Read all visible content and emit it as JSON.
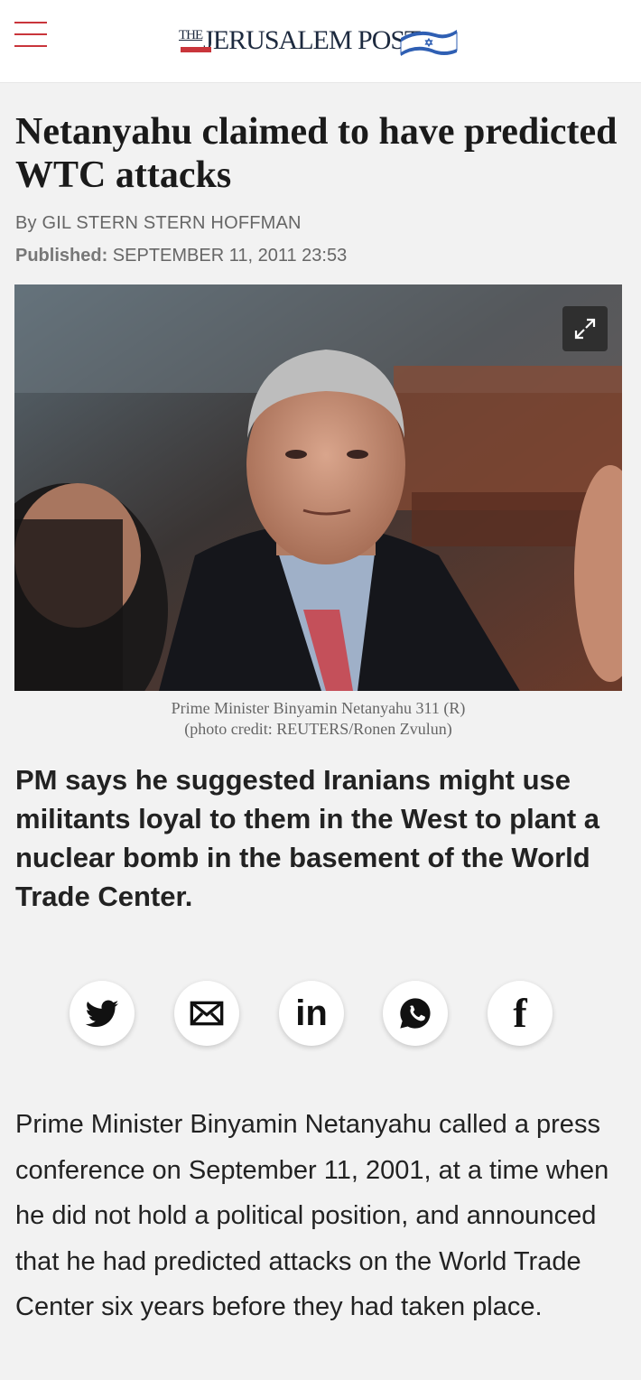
{
  "header": {
    "logo": {
      "the": "THE",
      "name": "JERUSALEM POST"
    }
  },
  "article": {
    "headline": "Netanyahu claimed to have predicted WTC attacks",
    "byline": "By GIL STERN STERN HOFFMAN",
    "published_label": "Published:",
    "published_date": "SEPTEMBER 11, 2011 23:53",
    "image": {
      "caption_line1": "Prime Minister Binyamin Netanyahu 311 (R)",
      "caption_line2": "(photo credit: REUTERS/Ronen Zvulun)"
    },
    "subheadline": "PM says he suggested Iranians might use militants loyal to them in the West to plant a nuclear bomb in the basement of the World Trade Center.",
    "body": "Prime Minister Binyamin Netanyahu called a press conference on September 11, 2001, at a time when he did not hold a political position, and announced that he had predicted attacks on the World Trade Center six years before they had taken place."
  },
  "share": {
    "items": [
      {
        "icon": "twitter-icon"
      },
      {
        "icon": "email-icon"
      },
      {
        "icon": "linkedin-icon",
        "label": "in"
      },
      {
        "icon": "whatsapp-icon"
      },
      {
        "icon": "facebook-icon",
        "label": "f"
      }
    ]
  },
  "colors": {
    "accent_red": "#c9353b",
    "logo_navy": "#1d2a3f",
    "flag_blue": "#2f5fb3",
    "background": "#f2f2f2"
  }
}
